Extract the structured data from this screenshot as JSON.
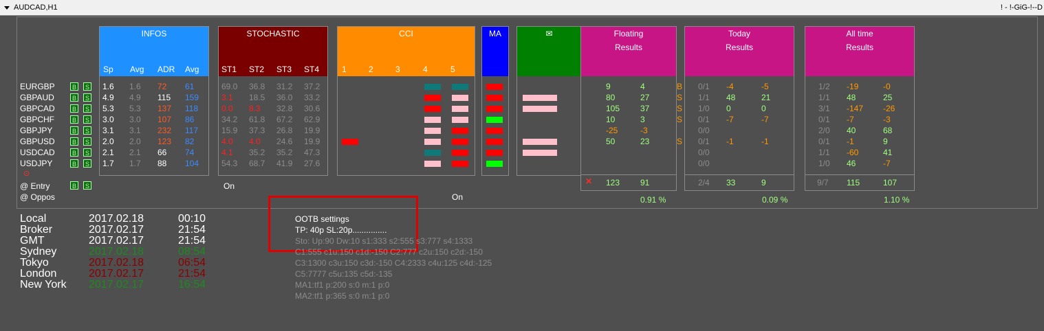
{
  "window": {
    "title": "AUDCAD,H1",
    "right_label": "! - !-GiG-!--D"
  },
  "headers": {
    "infos": "INFOS",
    "stochastic": "STOCHASTIC",
    "cci": "CCI",
    "ma": "MA",
    "mail_icon": "✉",
    "floating": [
      "Floating",
      "Results"
    ],
    "today": [
      "Today",
      "Results"
    ],
    "alltime": [
      "All time",
      "Results"
    ],
    "infos_cols": [
      "Sp",
      "Avg",
      "ADR",
      "Avg"
    ],
    "stoch_cols": [
      "ST1",
      "ST2",
      "ST3",
      "ST4"
    ],
    "cci_cols": [
      "1",
      "2",
      "3",
      "4",
      "5"
    ]
  },
  "buttons": {
    "b": "B",
    "s": "S"
  },
  "symbols": [
    {
      "name": "EURGBP",
      "sp": "1.6",
      "avg": "1.6",
      "adr": "72",
      "adr_color": "#ff5a2a",
      "avg2": "61",
      "st": [
        "69.0",
        "36.8",
        "31.2",
        "37.2"
      ],
      "st_colors": [
        "#8c8c8c",
        "#8c8c8c",
        "#8c8c8c",
        "#8c8c8c"
      ],
      "cci": [
        "",
        "",
        "",
        "#0f7a7a",
        "#0f7a7a"
      ],
      "ma": "#ff0000",
      "mail": "",
      "float_x": true,
      "f1": "9",
      "f1c": "#a0ff80",
      "f2": "4",
      "f2c": "#a0ff80",
      "tag": "B",
      "today_ratio": "0/1",
      "t1": "-4",
      "t1c": "#ff9900",
      "t2": "-5",
      "t2c": "#ff9900",
      "all_ratio": "1/2",
      "a1": "-19",
      "a1c": "#ff9900",
      "a2": "-0",
      "a2c": "#ff9900"
    },
    {
      "name": "GBPAUD",
      "sp": "4.9",
      "avg": "4.9",
      "adr": "115",
      "adr_color": "#ffffff",
      "avg2": "159",
      "st": [
        "3.1",
        "18.5",
        "36.0",
        "33.2"
      ],
      "st_colors": [
        "#ff2020",
        "#8c8c8c",
        "#8c8c8c",
        "#8c8c8c"
      ],
      "cci": [
        "",
        "",
        "",
        "#ff0000",
        "#ffc0cb"
      ],
      "ma": "#ff0000",
      "mail": "#ffc0cb",
      "float_x": true,
      "f1": "80",
      "f1c": "#a0ff80",
      "f2": "27",
      "f2c": "#a0ff80",
      "tag": "S",
      "today_ratio": "1/1",
      "t1": "48",
      "t1c": "#a0ff80",
      "t2": "21",
      "t2c": "#a0ff80",
      "all_ratio": "1/1",
      "a1": "48",
      "a1c": "#a0ff80",
      "a2": "25",
      "a2c": "#a0ff80"
    },
    {
      "name": "GBPCAD",
      "sp": "5.3",
      "avg": "5.3",
      "adr": "137",
      "adr_color": "#ff5a2a",
      "avg2": "118",
      "st": [
        "0.0",
        "8.3",
        "32.8",
        "30.6"
      ],
      "st_colors": [
        "#ff2020",
        "#ff2020",
        "#8c8c8c",
        "#8c8c8c"
      ],
      "cci": [
        "",
        "",
        "",
        "#ff0000",
        "#ffc0cb"
      ],
      "ma": "#ff0000",
      "mail": "#ffc0cb",
      "float_x": true,
      "f1": "105",
      "f1c": "#a0ff80",
      "f2": "37",
      "f2c": "#a0ff80",
      "tag": "S",
      "today_ratio": "1/0",
      "t1": "0",
      "t1c": "#a0ff80",
      "t2": "0",
      "t2c": "#a0ff80",
      "all_ratio": "3/1",
      "a1": "-147",
      "a1c": "#ff9900",
      "a2": "-26",
      "a2c": "#ff9900"
    },
    {
      "name": "GBPCHF",
      "sp": "3.0",
      "avg": "3.0",
      "adr": "107",
      "adr_color": "#ff5a2a",
      "avg2": "86",
      "st": [
        "34.2",
        "61.8",
        "67.2",
        "62.9"
      ],
      "st_colors": [
        "#8c8c8c",
        "#8c8c8c",
        "#8c8c8c",
        "#8c8c8c"
      ],
      "cci": [
        "",
        "",
        "",
        "#ffc0cb",
        "#ffc0cb"
      ],
      "ma": "#00ff00",
      "mail": "",
      "float_x": true,
      "f1": "10",
      "f1c": "#a0ff80",
      "f2": "3",
      "f2c": "#a0ff80",
      "tag": "S",
      "today_ratio": "0/1",
      "t1": "-7",
      "t1c": "#ff9900",
      "t2": "-7",
      "t2c": "#ff9900",
      "all_ratio": "0/1",
      "a1": "-7",
      "a1c": "#ff9900",
      "a2": "-3",
      "a2c": "#ff9900"
    },
    {
      "name": "GBPJPY",
      "sp": "3.1",
      "avg": "3.1",
      "adr": "232",
      "adr_color": "#ff5a2a",
      "avg2": "117",
      "st": [
        "15.9",
        "37.3",
        "26.8",
        "19.9"
      ],
      "st_colors": [
        "#8c8c8c",
        "#8c8c8c",
        "#8c8c8c",
        "#8c8c8c"
      ],
      "cci": [
        "",
        "",
        "",
        "#ffc0cb",
        "#ff0000"
      ],
      "ma": "#ff0000",
      "mail": "",
      "float_x": true,
      "f1": "-25",
      "f1c": "#ff9900",
      "f2": "-3",
      "f2c": "#ff9900",
      "tag": "",
      "today_ratio": "0/0",
      "t1": "",
      "t1c": "#ff9900",
      "t2": "",
      "t2c": "#ff9900",
      "all_ratio": "2/0",
      "a1": "40",
      "a1c": "#a0ff80",
      "a2": "68",
      "a2c": "#a0ff80"
    },
    {
      "name": "GBPUSD",
      "sp": "2.0",
      "avg": "2.0",
      "adr": "123",
      "adr_color": "#ff5a2a",
      "avg2": "82",
      "st": [
        "4.0",
        "4.0",
        "24.6",
        "19.9"
      ],
      "st_colors": [
        "#ff2020",
        "#ff2020",
        "#8c8c8c",
        "#8c8c8c"
      ],
      "cci": [
        "#ff0000",
        "",
        "",
        "#ffc0cb",
        "#ff0000"
      ],
      "ma": "#ff0000",
      "mail": "#ffc0cb",
      "float_x": true,
      "f1": "50",
      "f1c": "#a0ff80",
      "f2": "23",
      "f2c": "#a0ff80",
      "tag": "S",
      "today_ratio": "0/1",
      "t1": "-1",
      "t1c": "#ff9900",
      "t2": "-1",
      "t2c": "#ff9900",
      "all_ratio": "0/1",
      "a1": "-1",
      "a1c": "#ff9900",
      "a2": "9",
      "a2c": "#a0ff80"
    },
    {
      "name": "USDCAD",
      "sp": "2.1",
      "avg": "2.1",
      "adr": "66",
      "adr_color": "#ffffff",
      "avg2": "74",
      "st": [
        "4.1",
        "35.2",
        "35.2",
        "47.3"
      ],
      "st_colors": [
        "#ff2020",
        "#8c8c8c",
        "#8c8c8c",
        "#8c8c8c"
      ],
      "cci": [
        "",
        "",
        "",
        "#0f7a7a",
        "#ff0000"
      ],
      "ma": "#ff0000",
      "mail": "#ffc0cb",
      "float_x": false,
      "f1": "",
      "f1c": "#a0ff80",
      "f2": "",
      "f2c": "#a0ff80",
      "tag": "",
      "today_ratio": "0/0",
      "t1": "",
      "t1c": "#a0ff80",
      "t2": "",
      "t2c": "#a0ff80",
      "all_ratio": "1/1",
      "a1": "-60",
      "a1c": "#ff9900",
      "a2": "41",
      "a2c": "#a0ff80"
    },
    {
      "name": "USDJPY",
      "sp": "1.7",
      "avg": "1.7",
      "adr": "88",
      "adr_color": "#ffffff",
      "avg2": "104",
      "st": [
        "54.3",
        "68.7",
        "41.9",
        "27.6"
      ],
      "st_colors": [
        "#8c8c8c",
        "#8c8c8c",
        "#8c8c8c",
        "#8c8c8c"
      ],
      "cci": [
        "",
        "",
        "",
        "#ffc0cb",
        "#ff0000"
      ],
      "ma": "#00ff00",
      "mail": "",
      "float_x": false,
      "f1": "",
      "f1c": "#a0ff80",
      "f2": "",
      "f2c": "#a0ff80",
      "tag": "",
      "today_ratio": "0/0",
      "t1": "",
      "t1c": "#a0ff80",
      "t2": "",
      "t2c": "#a0ff80",
      "all_ratio": "1/0",
      "a1": "46",
      "a1c": "#a0ff80",
      "a2": "-7",
      "a2c": "#ff9900"
    }
  ],
  "rows_extra": {
    "entry": "@ Entry",
    "oppos": "@ Oppos",
    "stoch_on": "On",
    "cci_on": "On"
  },
  "totals": {
    "floating": {
      "a": "123",
      "b": "91",
      "pct": "0.91 %"
    },
    "today": {
      "ratio": "2/4",
      "a": "33",
      "b": "9",
      "pct": "0.09 %"
    },
    "alltime": {
      "ratio": "9/7",
      "a": "115",
      "b": "107",
      "pct": "1.10 %"
    }
  },
  "clocks": [
    {
      "name": "Local",
      "date": "2017.02.18",
      "time": "00:10",
      "color": "#ffffff"
    },
    {
      "name": "Broker",
      "date": "2017.02.17",
      "time": "21:54",
      "color": "#ffffff"
    },
    {
      "name": "GMT",
      "date": "2017.02.17",
      "time": "21:54",
      "color": "#ffffff"
    },
    {
      "name": "Sydney",
      "date": "2017.02.18",
      "time": "08:54",
      "color": "#1f8a1f"
    },
    {
      "name": "Tokyo",
      "date": "2017.02.18",
      "time": "06:54",
      "color": "#8b0000"
    },
    {
      "name": "London",
      "date": "2017.02.17",
      "time": "21:54",
      "color": "#8b0000"
    },
    {
      "name": "New York",
      "date": "2017.02.17",
      "time": "16:54",
      "color": "#1f8a1f"
    }
  ],
  "settings": {
    "title": "OOTB settings",
    "tpsl": "TP: 40p SL:20p...............",
    "lines": [
      "Sto: Up:90 Dw:10 s1:333 s2:555 s3:777 s4:1333",
      "C1:555 c1u:150 c1d:-150 C2:777 c2u:150 c2d:-150",
      "C3:1300 c3u:150 c3d:-150 C4:2333 c4u:125 c4d:-125",
      "C5:7777 c5u:135 c5d:-135",
      "MA1:tf1 p:200 s:0 m:1 p:0",
      "MA2:tf1 p:365 s:0 m:1 p:0"
    ]
  },
  "colors": {
    "infos": "#1e90ff",
    "stoch": "#7a0000",
    "cci": "#ff8c00",
    "ma": "#0000ff",
    "mail": "#008000",
    "results": "#c71585",
    "highlight": "#ff0000"
  }
}
